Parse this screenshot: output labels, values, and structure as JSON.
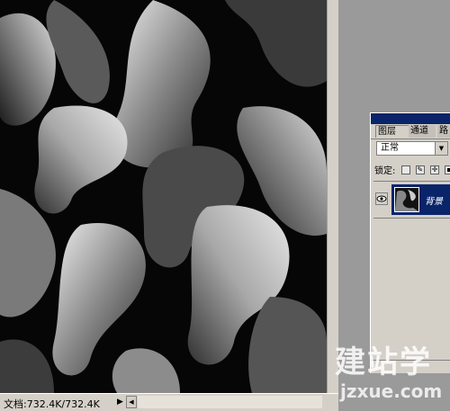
{
  "status": {
    "doc_info": "文档:732.4K/732.4K"
  },
  "layers_panel": {
    "tabs": [
      "图层",
      "通道",
      "路"
    ],
    "blend_mode": "正常",
    "lock_label": "锁定:",
    "layers": [
      {
        "name": "背景",
        "visible": true,
        "selected": true
      }
    ]
  },
  "watermark": {
    "text": "建站学",
    "subtext": "jzxue.com"
  },
  "colors": {
    "selection": "#0a246a",
    "ui_gray": "#d4d0c8",
    "backdrop": "#9a9a9a"
  }
}
